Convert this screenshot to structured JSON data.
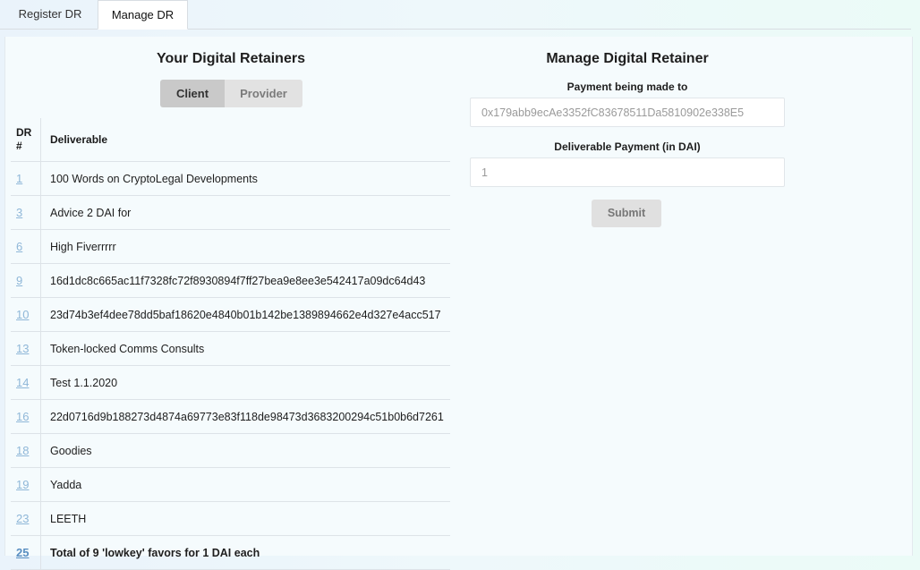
{
  "tabs": [
    {
      "label": "Register DR"
    },
    {
      "label": "Manage DR"
    }
  ],
  "left": {
    "title": "Your Digital Retainers",
    "toggle": {
      "client": "Client",
      "provider": "Provider"
    },
    "table": {
      "headers": {
        "num": "DR #",
        "deliverable": "Deliverable"
      },
      "rows": [
        {
          "id": "1",
          "deliverable": "100 Words on CryptoLegal Developments"
        },
        {
          "id": "3",
          "deliverable": "Advice 2 DAI for"
        },
        {
          "id": "6",
          "deliverable": "High Fiverrrrr"
        },
        {
          "id": "9",
          "deliverable": "16d1dc8c665ac11f7328fc72f8930894f7ff27bea9e8ee3e542417a09dc64d43"
        },
        {
          "id": "10",
          "deliverable": "23d74b3ef4dee78dd5baf18620e4840b01b142be1389894662e4d327e4acc517"
        },
        {
          "id": "13",
          "deliverable": "Token-locked Comms Consults"
        },
        {
          "id": "14",
          "deliverable": "Test 1.1.2020"
        },
        {
          "id": "16",
          "deliverable": "22d0716d9b188273d4874a69773e83f118de98473d3683200294c51b0b6d7261"
        },
        {
          "id": "18",
          "deliverable": "Goodies"
        },
        {
          "id": "19",
          "deliverable": "Yadda"
        },
        {
          "id": "23",
          "deliverable": "LEETH"
        },
        {
          "id": "25",
          "deliverable": "Total of 9 'lowkey' favors for 1 DAI each"
        }
      ]
    }
  },
  "right": {
    "title": "Manage Digital Retainer",
    "payment_to_label": "Payment being made to",
    "payment_to_value": "0x179abb9ecAe3352fC83678511Da5810902e338E5",
    "amount_label": "Deliverable Payment (in DAI)",
    "amount_value": "1",
    "submit_label": "Submit"
  }
}
